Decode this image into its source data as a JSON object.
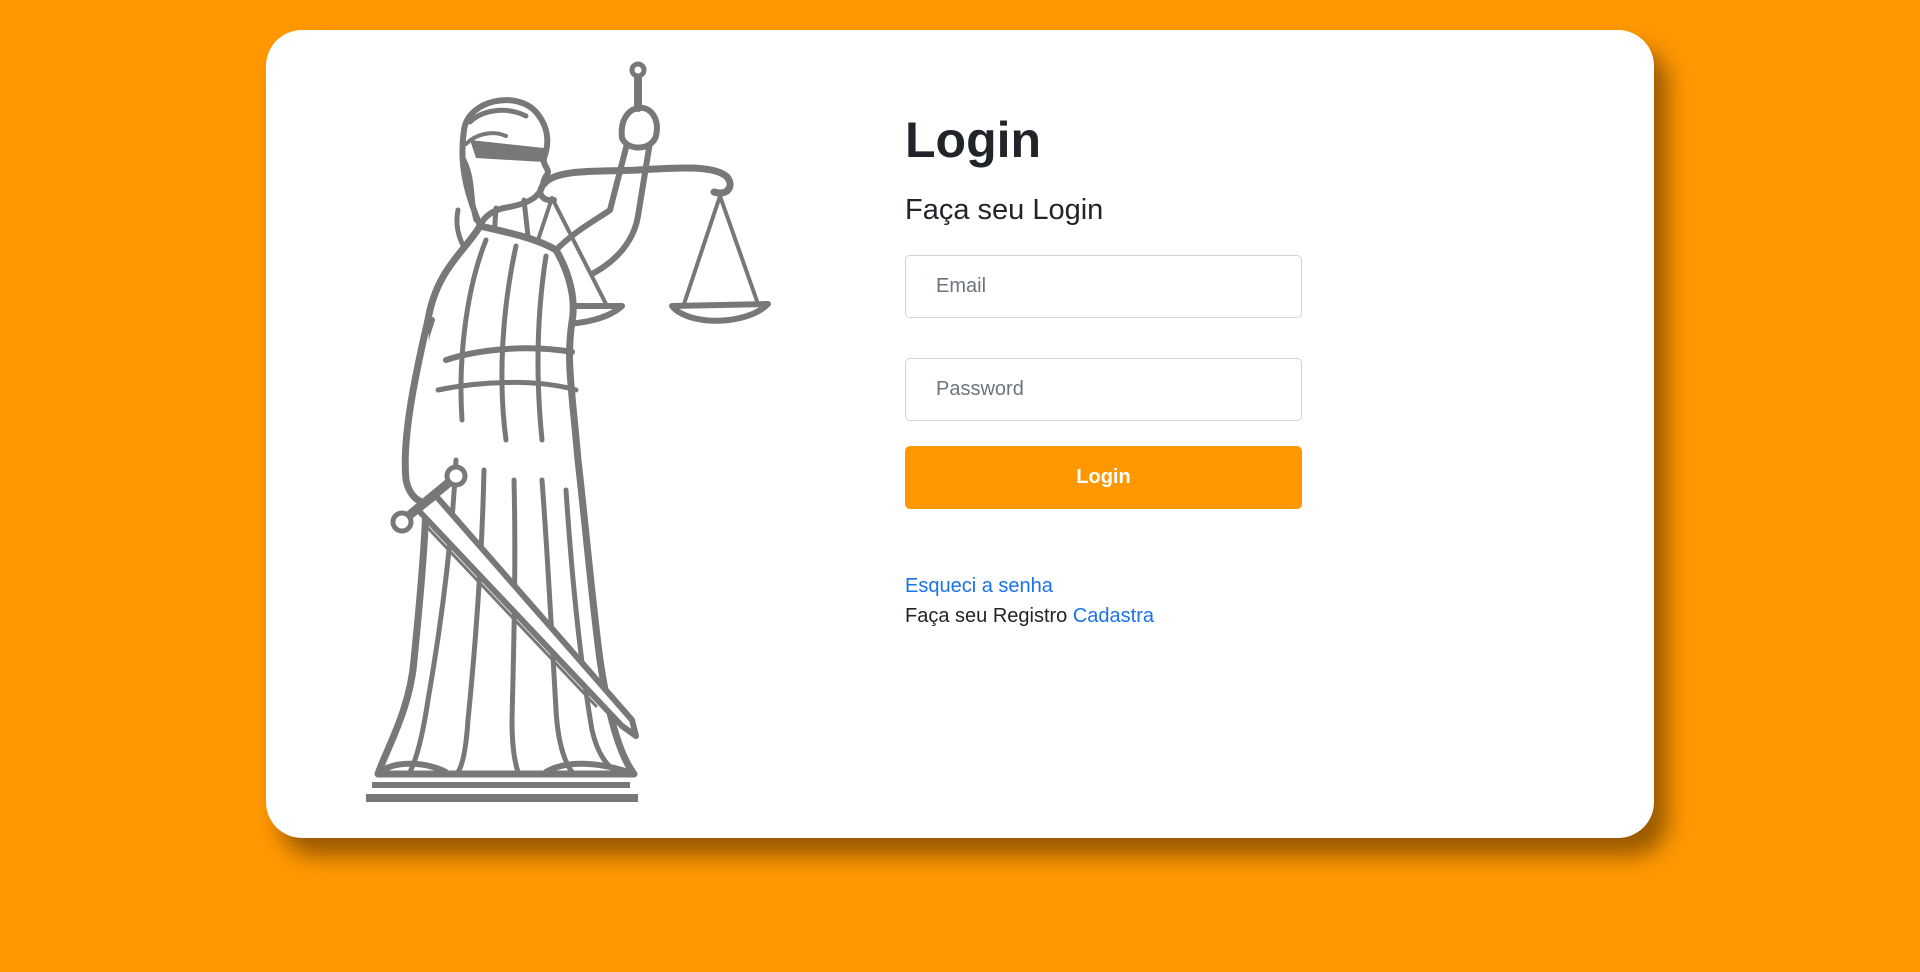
{
  "card": {
    "title": "Login",
    "subtitle": "Faça seu Login"
  },
  "form": {
    "email_placeholder": "Email",
    "password_placeholder": "Password",
    "login_button": "Login"
  },
  "links": {
    "forgot_password": "Esqueci a senha",
    "register_prompt": "Faça seu Registro",
    "register_link": "Cadastra"
  },
  "illustration": {
    "subject": "lady-justice-statue",
    "color": "#787878"
  },
  "colors": {
    "background": "#ff9800",
    "card": "#ffffff",
    "button": "#ff9800",
    "link": "#1a73e8",
    "text": "#212529"
  }
}
